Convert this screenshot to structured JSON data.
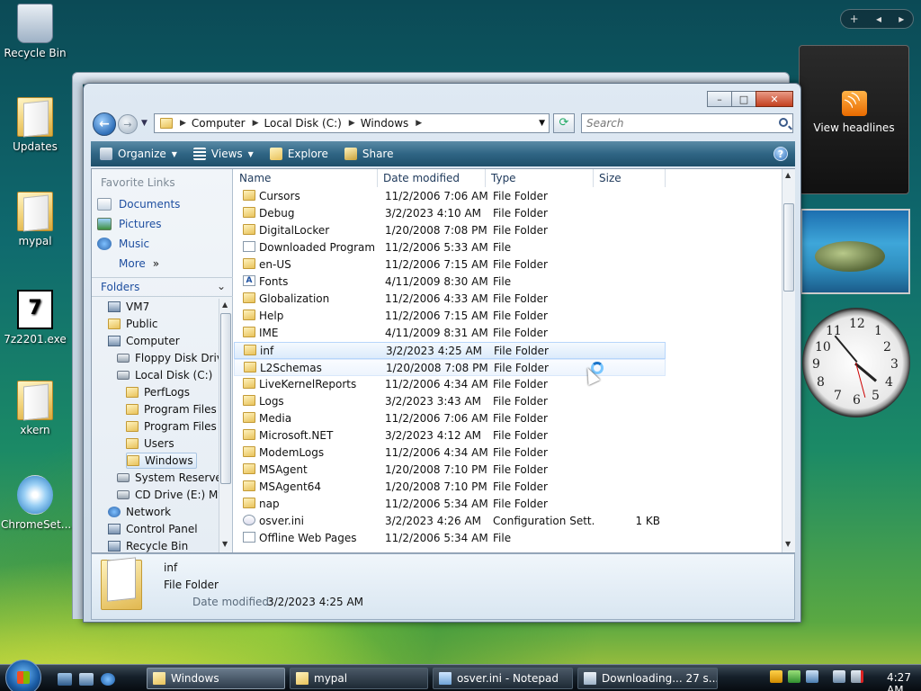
{
  "desktop": {
    "icons": [
      {
        "label": "Recycle Bin"
      },
      {
        "label": "Updates"
      },
      {
        "label": "mypal"
      },
      {
        "label": "7z2201.exe"
      },
      {
        "label": "xkern"
      },
      {
        "label": "ChromeSet..."
      }
    ]
  },
  "gadgets": {
    "feeds_label": "View headlines",
    "controls": {
      "add": "+",
      "prev": "◂",
      "next": "▸"
    },
    "clock_numbers": [
      "12",
      "1",
      "2",
      "3",
      "4",
      "5",
      "6",
      "7",
      "8",
      "9",
      "10",
      "11"
    ]
  },
  "window": {
    "breadcrumb": [
      "Computer",
      "Local Disk (C:)",
      "Windows"
    ],
    "search_placeholder": "Search",
    "toolbar": {
      "organize": "Organize",
      "views": "Views",
      "explore": "Explore",
      "share": "Share"
    },
    "favorite_links": {
      "title": "Favorite Links",
      "items": [
        "Documents",
        "Pictures",
        "Music"
      ],
      "more": "More"
    },
    "folders_label": "Folders",
    "tree": [
      {
        "label": "VM7",
        "icon": "computer"
      },
      {
        "label": "Public",
        "icon": "folder"
      },
      {
        "label": "Computer",
        "icon": "computer"
      },
      {
        "label": "Floppy Disk Drive",
        "icon": "drive"
      },
      {
        "label": "Local Disk (C:)",
        "icon": "drive"
      },
      {
        "label": "PerfLogs",
        "icon": "folder"
      },
      {
        "label": "Program Files",
        "icon": "folder"
      },
      {
        "label": "Program Files (",
        "icon": "folder"
      },
      {
        "label": "Users",
        "icon": "folder"
      },
      {
        "label": "Windows",
        "icon": "folder",
        "selected": true
      },
      {
        "label": "System Reserved",
        "icon": "drive"
      },
      {
        "label": "CD Drive (E:) My",
        "icon": "drive"
      },
      {
        "label": "Network",
        "icon": "network"
      },
      {
        "label": "Control Panel",
        "icon": "computer"
      },
      {
        "label": "Recycle Bin",
        "icon": "computer"
      }
    ],
    "columns": {
      "name": "Name",
      "date": "Date modified",
      "type": "Type",
      "size": "Size"
    },
    "files": [
      {
        "name": "Cursors",
        "date": "11/2/2006 7:06 AM",
        "type": "File Folder",
        "size": "",
        "icon": "folder"
      },
      {
        "name": "Debug",
        "date": "3/2/2023 4:10 AM",
        "type": "File Folder",
        "size": "",
        "icon": "folder"
      },
      {
        "name": "DigitalLocker",
        "date": "1/20/2008 7:08 PM",
        "type": "File Folder",
        "size": "",
        "icon": "folder"
      },
      {
        "name": "Downloaded Program ...",
        "date": "11/2/2006 5:33 AM",
        "type": "File",
        "size": "",
        "icon": "file"
      },
      {
        "name": "en-US",
        "date": "11/2/2006 7:15 AM",
        "type": "File Folder",
        "size": "",
        "icon": "folder"
      },
      {
        "name": "Fonts",
        "date": "4/11/2009 8:30 AM",
        "type": "File",
        "size": "",
        "icon": "font"
      },
      {
        "name": "Globalization",
        "date": "11/2/2006 4:33 AM",
        "type": "File Folder",
        "size": "",
        "icon": "folder"
      },
      {
        "name": "Help",
        "date": "11/2/2006 7:15 AM",
        "type": "File Folder",
        "size": "",
        "icon": "folder"
      },
      {
        "name": "IME",
        "date": "4/11/2009 8:31 AM",
        "type": "File Folder",
        "size": "",
        "icon": "folder"
      },
      {
        "name": "inf",
        "date": "3/2/2023 4:25 AM",
        "type": "File Folder",
        "size": "",
        "icon": "folder",
        "state": "sel"
      },
      {
        "name": "L2Schemas",
        "date": "1/20/2008 7:08 PM",
        "type": "File Folder",
        "size": "",
        "icon": "folder",
        "state": "hov"
      },
      {
        "name": "LiveKernelReports",
        "date": "11/2/2006 4:34 AM",
        "type": "File Folder",
        "size": "",
        "icon": "folder"
      },
      {
        "name": "Logs",
        "date": "3/2/2023 3:43 AM",
        "type": "File Folder",
        "size": "",
        "icon": "folder"
      },
      {
        "name": "Media",
        "date": "11/2/2006 7:06 AM",
        "type": "File Folder",
        "size": "",
        "icon": "folder"
      },
      {
        "name": "Microsoft.NET",
        "date": "3/2/2023 4:12 AM",
        "type": "File Folder",
        "size": "",
        "icon": "folder"
      },
      {
        "name": "ModemLogs",
        "date": "11/2/2006 4:34 AM",
        "type": "File Folder",
        "size": "",
        "icon": "folder"
      },
      {
        "name": "MSAgent",
        "date": "1/20/2008 7:10 PM",
        "type": "File Folder",
        "size": "",
        "icon": "folder"
      },
      {
        "name": "MSAgent64",
        "date": "1/20/2008 7:10 PM",
        "type": "File Folder",
        "size": "",
        "icon": "folder"
      },
      {
        "name": "nap",
        "date": "11/2/2006 5:34 AM",
        "type": "File Folder",
        "size": "",
        "icon": "folder"
      },
      {
        "name": "osver.ini",
        "date": "3/2/2023 4:26 AM",
        "type": "Configuration Sett...",
        "size": "1 KB",
        "icon": "ini"
      },
      {
        "name": "Offline Web Pages",
        "date": "11/2/2006 5:34 AM",
        "type": "File",
        "size": "",
        "icon": "file"
      }
    ],
    "details": {
      "name": "inf",
      "type": "File Folder",
      "date_label": "Date modified:",
      "date_value": "3/2/2023 4:25 AM"
    }
  },
  "taskbar": {
    "tasks": [
      {
        "label": "Windows",
        "active": true
      },
      {
        "label": "mypal",
        "active": false
      },
      {
        "label": "osver.ini - Notepad",
        "active": false
      },
      {
        "label": "Downloading... 27 s...",
        "active": false
      }
    ],
    "time": "4:27 AM"
  },
  "colors": {
    "link_blue": "#1f4fa0",
    "toolbar_blue": "#2f6584",
    "selection": "#dcebfb"
  }
}
